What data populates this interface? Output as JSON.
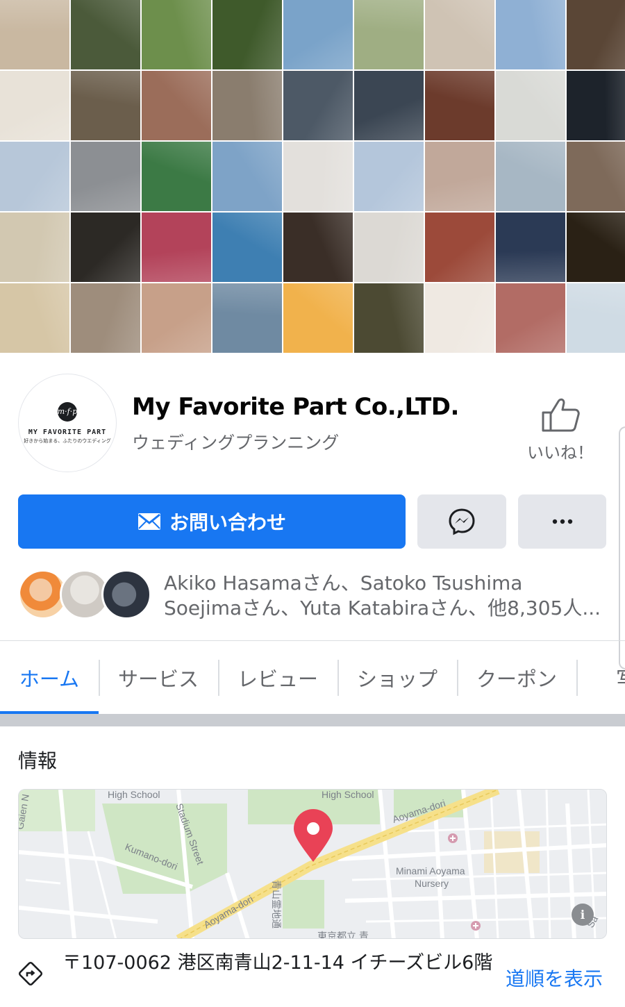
{
  "cover": {
    "tile_colors": [
      "#c9b8a1",
      "#4b5a3a",
      "#6d8f4c",
      "#3f5a2b",
      "#7aa3c9",
      "#9fae83",
      "#cfc3b4",
      "#8fb0d4",
      "#5a4636",
      "#e8e2d8",
      "#6b5e4c",
      "#9b6d5a",
      "#8a7d6e",
      "#4d5966",
      "#3b4653",
      "#6c3b2c",
      "#d9dad6",
      "#1d232b",
      "#b7c7d9",
      "#8c8f93",
      "#3c7a45",
      "#7ea3c7",
      "#e3e0dc",
      "#b4c6db",
      "#c1a89a",
      "#a7b7c4",
      "#7e6a5a",
      "#d2c8b1",
      "#2c2925",
      "#b3435a",
      "#3e7fb2",
      "#3a2e27",
      "#dcd9d4",
      "#9c4a3a",
      "#2b3a55",
      "#2a2115",
      "#d6c6a6",
      "#9e8d7c",
      "#c7a089",
      "#6f8aa2",
      "#f1b24c",
      "#4c4a33",
      "#efe9e2",
      "#b26c65",
      "#cfdbe4"
    ]
  },
  "avatar": {
    "mark": "m·f·p",
    "name": "MY FAVORITE PART",
    "tagline": "好きから始まる、ふたりのウエディング"
  },
  "header": {
    "title": "My Favorite Part Co.,LTD.",
    "category": "ウェディングプランニング"
  },
  "like": {
    "icon": "thumbs-up-icon",
    "label": "いいね！"
  },
  "actions": {
    "contact_label": "お問い合わせ",
    "contact_icon": "envelope-icon",
    "messenger_icon": "messenger-icon",
    "more_icon": "more-dots-icon"
  },
  "friends": {
    "line1": "Akiko Hasamaさん、Satoko Tsushima",
    "line2": "Soejimaさん、Yuta Katabiraさん、他8,305人..."
  },
  "tabs": [
    "ホーム",
    "サービス",
    "レビュー",
    "ショップ",
    "クーポン",
    "写真"
  ],
  "info": {
    "title": "情報",
    "map_labels": {
      "hs1": "High School",
      "hs2": "High School",
      "aoyama1": "Aoyama-dori",
      "aoyama2": "Aoyama-dori",
      "stadium": "Stadium Street",
      "kumano": "Kumano-dori",
      "gaien": "Gaien N",
      "nursery1": "Minami Aoyama",
      "nursery2": "Nursery",
      "cemetery": "青山霊地通",
      "tokyo": "東京都立 青",
      "edge": "Sa"
    },
    "address": "〒107-0062 港区南青山2-11-14 イチーズビル6階",
    "directions": "道順を表示",
    "accent_marker": "#e94256"
  }
}
